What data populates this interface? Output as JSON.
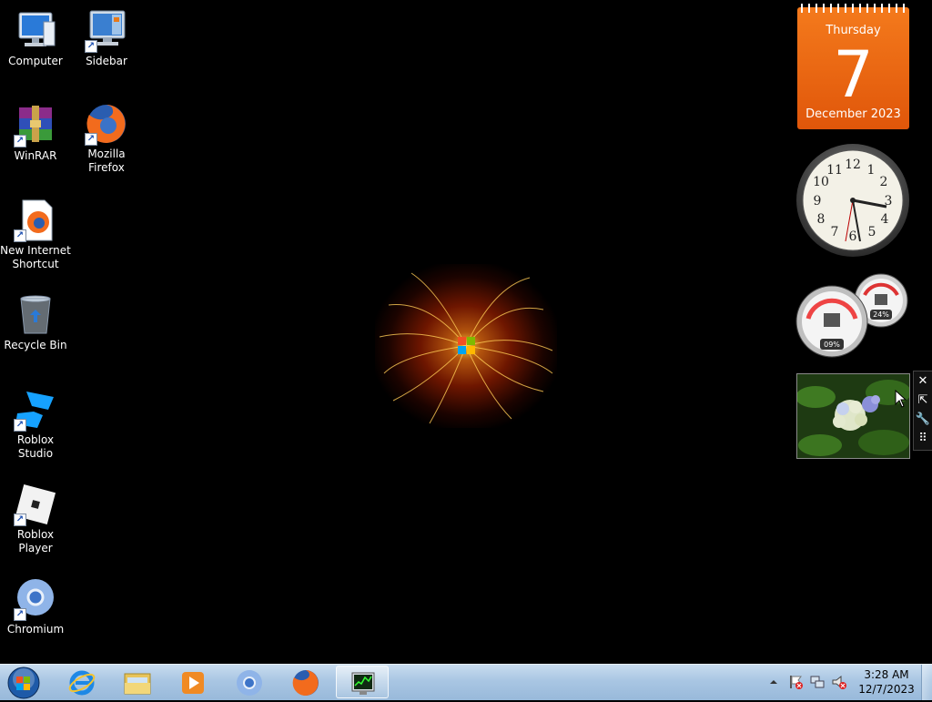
{
  "desktop_icons": [
    {
      "name": "computer",
      "label": "Computer"
    },
    {
      "name": "sidebar",
      "label": "Sidebar"
    },
    {
      "name": "winrar",
      "label": "WinRAR"
    },
    {
      "name": "mozilla-firefox",
      "label": "Mozilla Firefox"
    },
    {
      "name": "new-internet-shortcut",
      "label": "New Internet Shortcut"
    },
    {
      "name": "recycle-bin",
      "label": "Recycle Bin"
    },
    {
      "name": "roblox-studio",
      "label": "Roblox Studio"
    },
    {
      "name": "roblox-player",
      "label": "Roblox Player"
    },
    {
      "name": "chromium",
      "label": "Chromium"
    }
  ],
  "gadgets": {
    "calendar": {
      "day_name": "Thursday",
      "day_number": "7",
      "month_year": "December 2023"
    },
    "clock": {
      "numerals": [
        "12",
        "1",
        "2",
        "3",
        "4",
        "5",
        "6",
        "7",
        "8",
        "9",
        "10",
        "11"
      ]
    },
    "cpu_meter": {
      "cpu_percent": "09%",
      "memory_percent": "24%"
    },
    "slideshow": {
      "subject": "hydrangea flowers"
    },
    "controls": {
      "close": "✕",
      "size": "⇱",
      "options": "🔧",
      "drag": "⠿"
    }
  },
  "taskbar": {
    "start": "Start",
    "pinned": [
      {
        "name": "internet-explorer",
        "active": false
      },
      {
        "name": "windows-explorer",
        "active": false
      },
      {
        "name": "media-player",
        "active": false
      },
      {
        "name": "chromium",
        "active": false
      },
      {
        "name": "firefox",
        "active": false
      },
      {
        "name": "task-manager",
        "active": true
      }
    ],
    "tray": {
      "time": "3:28 AM",
      "date": "12/7/2023"
    }
  },
  "colors": {
    "calendar_orange": "#f0741a",
    "taskbar": "#a9c6e3"
  }
}
